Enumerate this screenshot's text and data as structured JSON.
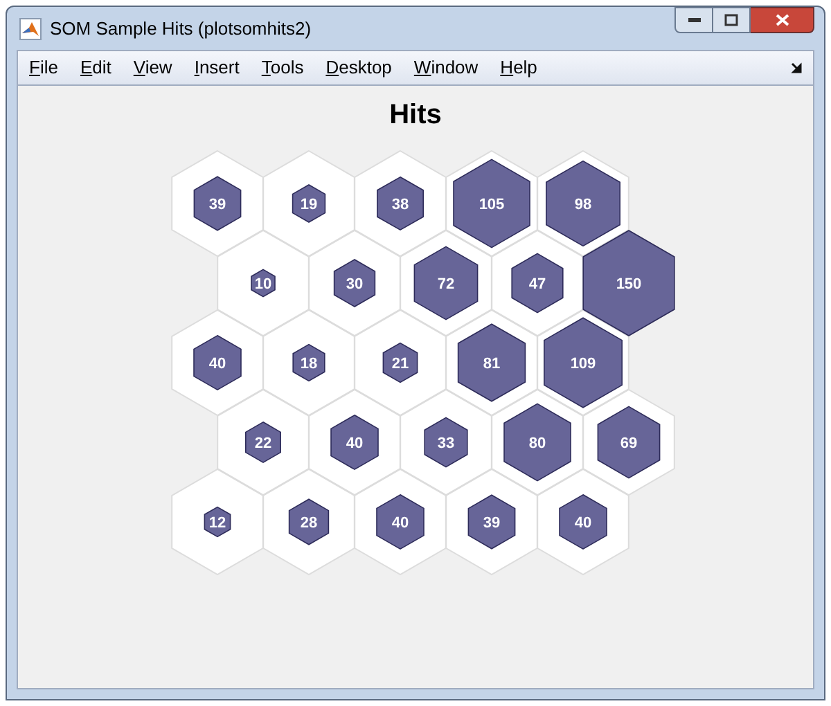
{
  "window": {
    "title": "SOM Sample Hits (plotsomhits2)"
  },
  "menu": [
    "File",
    "Edit",
    "View",
    "Insert",
    "Tools",
    "Desktop",
    "Window",
    "Help"
  ],
  "plot": {
    "title": "Hits",
    "rows": [
      [
        {
          "hits": "39"
        },
        {
          "hits": "19"
        },
        {
          "hits": "38"
        },
        {
          "hits": "105"
        },
        {
          "hits": "98"
        }
      ],
      [
        {
          "hits": "10"
        },
        {
          "hits": "30"
        },
        {
          "hits": "72"
        },
        {
          "hits": "47"
        },
        {
          "hits": "150"
        }
      ],
      [
        {
          "hits": "40"
        },
        {
          "hits": "18"
        },
        {
          "hits": "21"
        },
        {
          "hits": "81"
        },
        {
          "hits": "109"
        }
      ],
      [
        {
          "hits": "22"
        },
        {
          "hits": "40"
        },
        {
          "hits": "33"
        },
        {
          "hits": "80"
        },
        {
          "hits": "69"
        }
      ],
      [
        {
          "hits": "12"
        },
        {
          "hits": "28"
        },
        {
          "hits": "40"
        },
        {
          "hits": "39"
        },
        {
          "hits": "40"
        }
      ]
    ]
  }
}
